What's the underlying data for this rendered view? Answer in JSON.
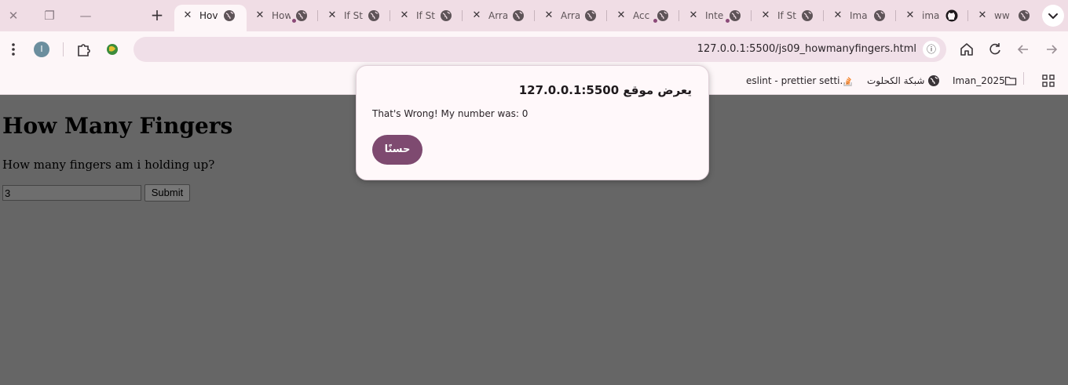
{
  "tabs": [
    {
      "title": "Hov",
      "active": true
    },
    {
      "title": "How"
    },
    {
      "title": "If St"
    },
    {
      "title": "If St"
    },
    {
      "title": "Arra"
    },
    {
      "title": "Arra"
    },
    {
      "title": "Acc"
    },
    {
      "title": "Inte"
    },
    {
      "title": "If St"
    },
    {
      "title": "Ima"
    },
    {
      "title": "ima"
    },
    {
      "title": "ww"
    }
  ],
  "toolbar": {
    "profile_initial": "I",
    "url": "127.0.0.1:5500/js09_howmanyfingers.html"
  },
  "bookmarks": [
    {
      "label": "eslint - prettier setti..."
    },
    {
      "label": "شبكة الكحلوت"
    },
    {
      "label": "Iman_2025"
    }
  ],
  "page": {
    "heading": "How Many Fingers",
    "question": "How many fingers am i holding up?",
    "answer_value": "3",
    "submit_label": "Submit"
  },
  "dialog": {
    "title": "يعرض موقع 127.0.0.1:5500",
    "message": "That's Wrong! My number was: 0",
    "ok_label": "حسنًا"
  },
  "colors": {
    "tabstrip": "#f0dde5",
    "toolbar": "#fdf6f8",
    "page_overlay": "#666666",
    "dialog_button": "#7e4a70"
  }
}
